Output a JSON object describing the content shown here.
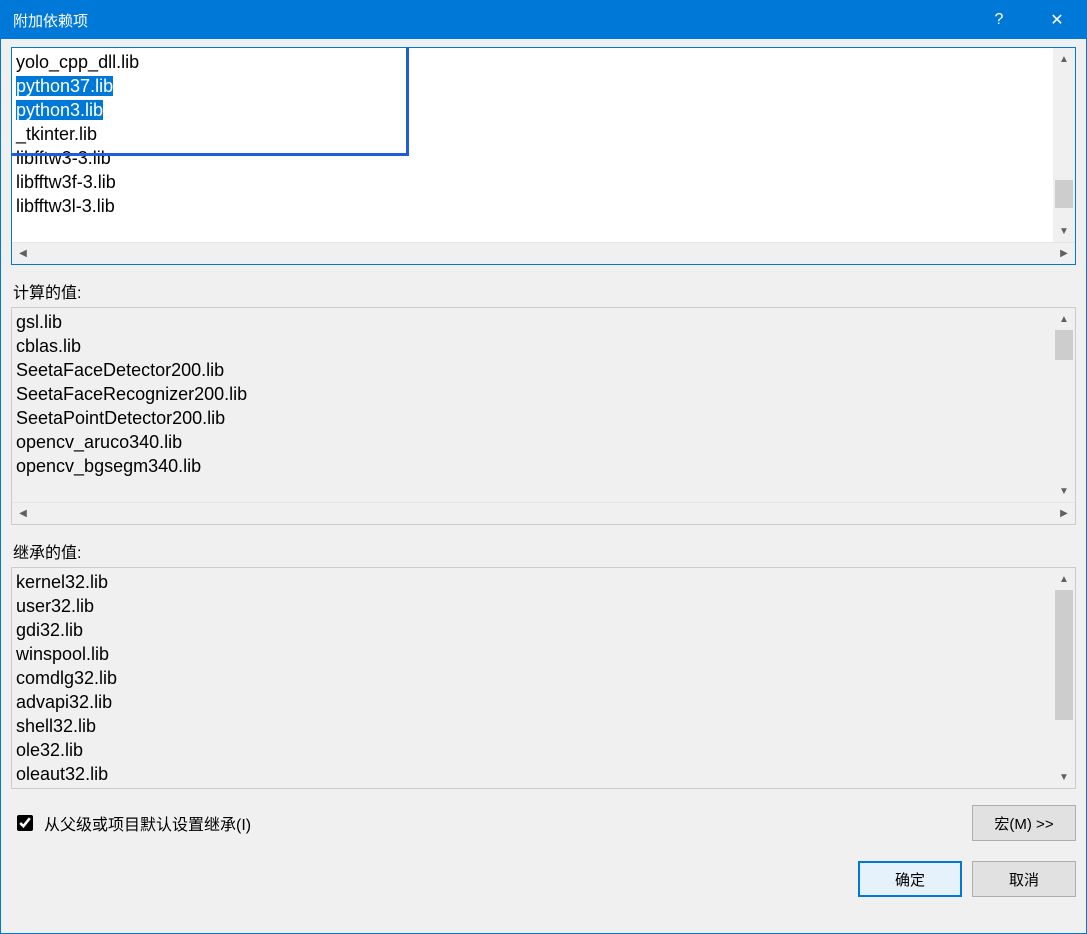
{
  "titlebar": {
    "title": "附加依赖项",
    "help_label": "?",
    "close_label": "✕"
  },
  "top_editor": {
    "lines": [
      "yolo_cpp_dll.lib",
      "python37.lib",
      "python3.lib",
      "_tkinter.lib",
      "libfftw3-3.lib",
      "libfftw3f-3.lib",
      "libfftw3l-3.lib"
    ]
  },
  "computed": {
    "label": "计算的值:",
    "lines": [
      "gsl.lib",
      "cblas.lib",
      "SeetaFaceDetector200.lib",
      "SeetaFaceRecognizer200.lib",
      "SeetaPointDetector200.lib",
      "opencv_aruco340.lib",
      "opencv_bgsegm340.lib"
    ]
  },
  "inherited": {
    "label": "继承的值:",
    "lines": [
      "kernel32.lib",
      "user32.lib",
      "gdi32.lib",
      "winspool.lib",
      "comdlg32.lib",
      "advapi32.lib",
      "shell32.lib",
      "ole32.lib",
      "oleaut32.lib"
    ]
  },
  "inherit_checkbox": "从父级或项目默认设置继承(I)",
  "macros_button": "宏(M) >>",
  "ok_button": "确定",
  "cancel_button": "取消"
}
